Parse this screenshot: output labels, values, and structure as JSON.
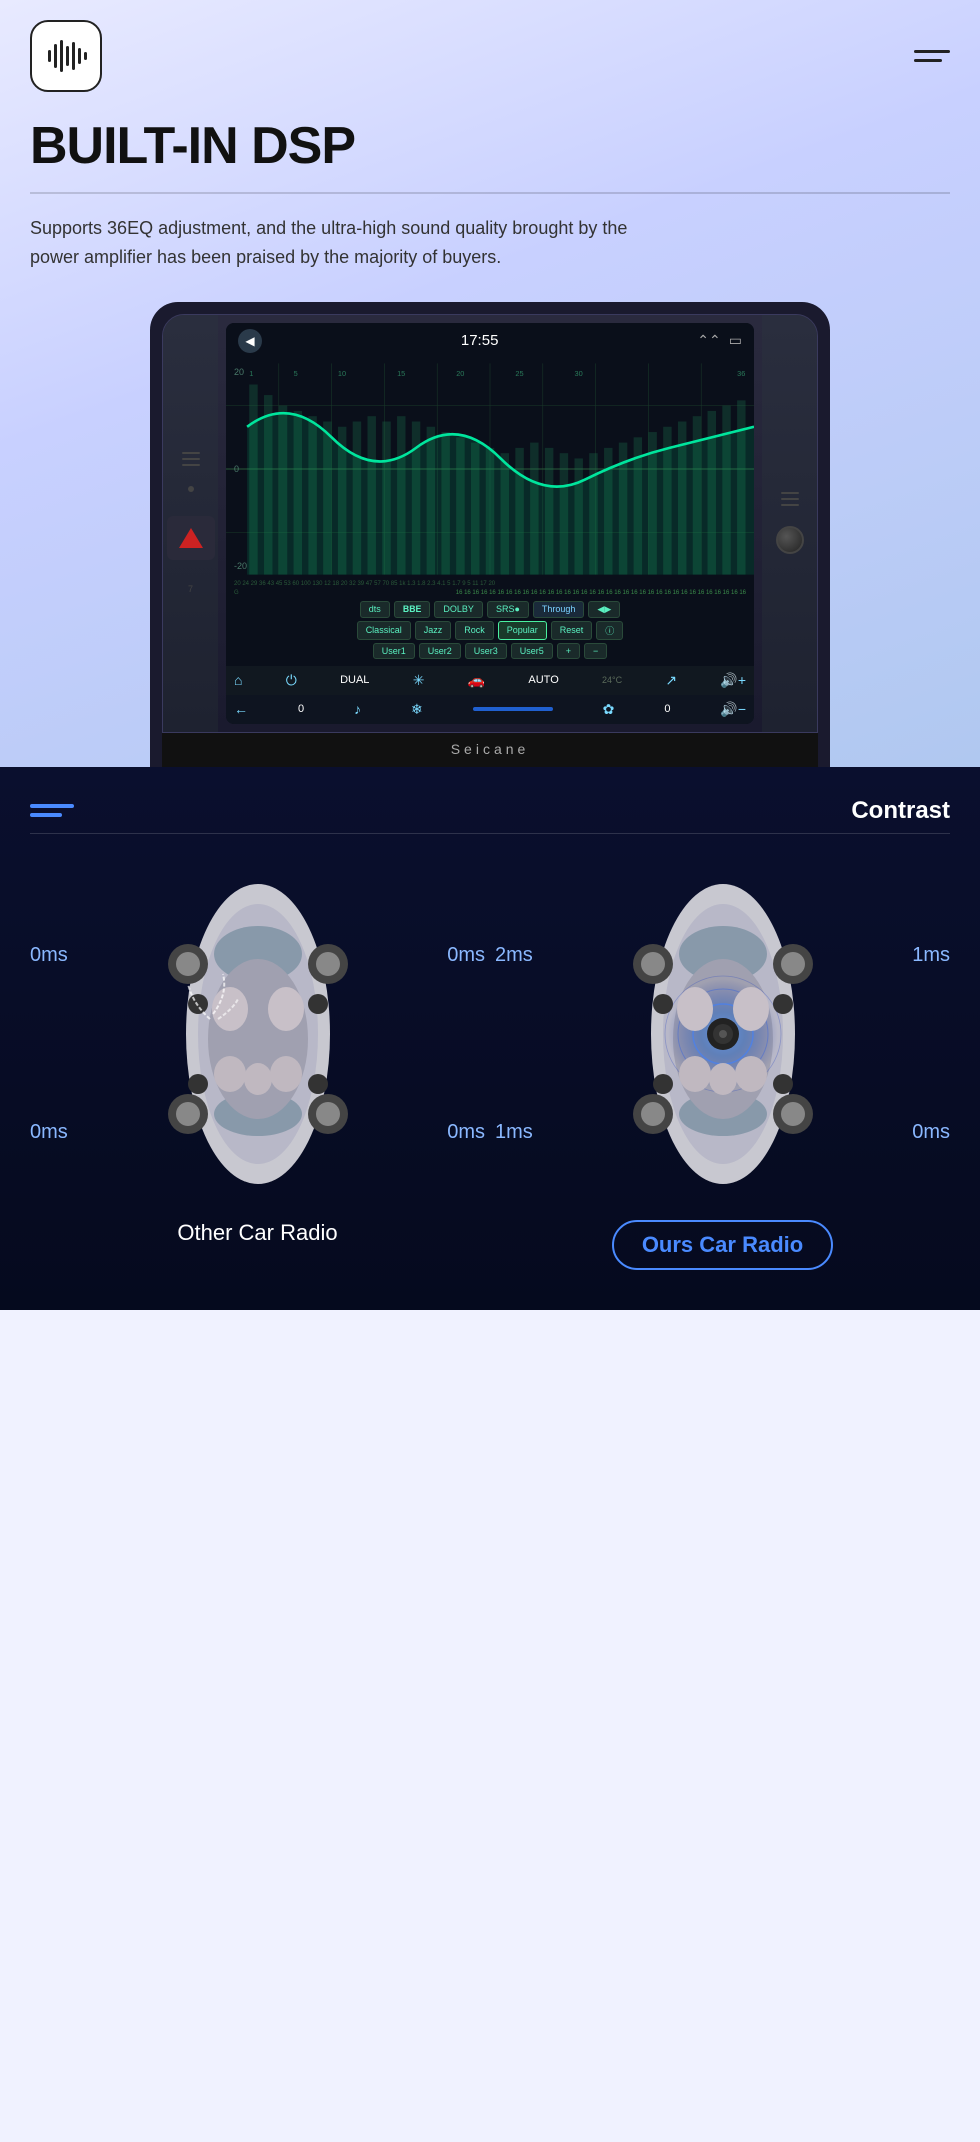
{
  "header": {
    "logo_alt": "sound-wave logo",
    "hamburger_label": "menu"
  },
  "hero": {
    "title": "BUILT-IN DSP",
    "divider": true,
    "description": "Supports 36EQ adjustment, and the ultra-high sound quality brought by the power amplifier has been praised by the majority of buyers."
  },
  "screen": {
    "time": "17:55",
    "back": "◀",
    "db_labels": [
      "20",
      "0",
      "-20"
    ],
    "eq_buttons_row1": [
      "dts",
      "BBE",
      "DOLBY",
      "SRS●",
      "Through",
      "◀▶"
    ],
    "eq_buttons_row2": [
      "Classical",
      "Jazz",
      "Rock",
      "Popular",
      "Reset",
      "ℹ"
    ],
    "eq_buttons_row3": [
      "User1",
      "User2",
      "User3",
      "User5",
      "+",
      "−"
    ],
    "bottom_nav": [
      "⌂",
      "⏻",
      "DUAL",
      "✳",
      "🚗",
      "AUTO",
      "↗",
      "🔊+"
    ],
    "bottom_nav2": [
      "←",
      "0",
      "♪",
      "❄",
      "—",
      "✿",
      "0",
      "🔊−"
    ],
    "temp": "24°C"
  },
  "contrast": {
    "label": "Contrast",
    "lines": [
      44,
      32
    ]
  },
  "comparison": {
    "other_car": {
      "label": "Other Car Radio",
      "ms_labels": {
        "top_left": "0ms",
        "top_right": "0ms",
        "bottom_left": "0ms",
        "bottom_right": "0ms"
      }
    },
    "ours_car": {
      "label": "Ours Car Radio",
      "ms_labels": {
        "top_left": "2ms",
        "top_right": "1ms",
        "bottom_left": "1ms",
        "bottom_right": "0ms"
      }
    }
  }
}
